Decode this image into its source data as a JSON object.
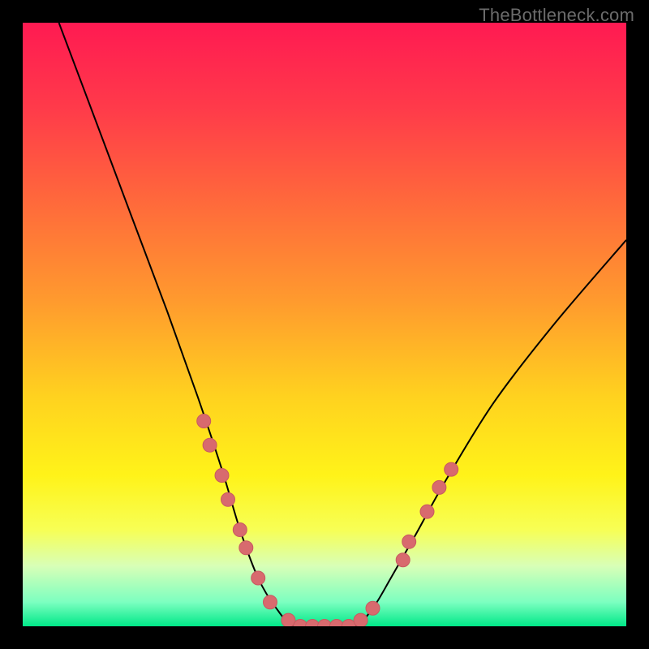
{
  "watermark": "TheBottleneck.com",
  "colors": {
    "gradient_stops": [
      {
        "offset": 0.0,
        "color": "#ff1a52"
      },
      {
        "offset": 0.14,
        "color": "#ff3a4a"
      },
      {
        "offset": 0.3,
        "color": "#ff6a3b"
      },
      {
        "offset": 0.46,
        "color": "#ff9a2e"
      },
      {
        "offset": 0.62,
        "color": "#ffd21f"
      },
      {
        "offset": 0.75,
        "color": "#fff319"
      },
      {
        "offset": 0.84,
        "color": "#f7ff55"
      },
      {
        "offset": 0.9,
        "color": "#d8ffb7"
      },
      {
        "offset": 0.96,
        "color": "#7cffc0"
      },
      {
        "offset": 1.0,
        "color": "#00e888"
      }
    ],
    "curve": "#000000",
    "marker_fill": "#d86a6e",
    "marker_stroke": "#c85a60",
    "frame": "#000000"
  },
  "chart_data": {
    "type": "line",
    "title": "",
    "xlabel": "",
    "ylabel": "",
    "xlim": [
      0,
      100
    ],
    "ylim": [
      0,
      100
    ],
    "curve": {
      "comment": "V-shaped bottleneck curve; y is mismatch percent (0 at valley floor).",
      "points": [
        {
          "x": 6,
          "y": 100
        },
        {
          "x": 12,
          "y": 84
        },
        {
          "x": 18,
          "y": 68
        },
        {
          "x": 24,
          "y": 52
        },
        {
          "x": 29,
          "y": 38
        },
        {
          "x": 33,
          "y": 26
        },
        {
          "x": 36,
          "y": 16
        },
        {
          "x": 39,
          "y": 8
        },
        {
          "x": 42,
          "y": 3
        },
        {
          "x": 45,
          "y": 0
        },
        {
          "x": 50,
          "y": 0
        },
        {
          "x": 55,
          "y": 0
        },
        {
          "x": 58,
          "y": 3
        },
        {
          "x": 61,
          "y": 8
        },
        {
          "x": 65,
          "y": 15
        },
        {
          "x": 70,
          "y": 24
        },
        {
          "x": 78,
          "y": 37
        },
        {
          "x": 88,
          "y": 50
        },
        {
          "x": 100,
          "y": 64
        }
      ]
    },
    "markers": {
      "comment": "highlighted sample points along the curve",
      "points": [
        {
          "x": 30,
          "y": 34
        },
        {
          "x": 31,
          "y": 30
        },
        {
          "x": 33,
          "y": 25
        },
        {
          "x": 34,
          "y": 21
        },
        {
          "x": 36,
          "y": 16
        },
        {
          "x": 37,
          "y": 13
        },
        {
          "x": 39,
          "y": 8
        },
        {
          "x": 41,
          "y": 4
        },
        {
          "x": 44,
          "y": 1
        },
        {
          "x": 46,
          "y": 0
        },
        {
          "x": 48,
          "y": 0
        },
        {
          "x": 50,
          "y": 0
        },
        {
          "x": 52,
          "y": 0
        },
        {
          "x": 54,
          "y": 0
        },
        {
          "x": 56,
          "y": 1
        },
        {
          "x": 58,
          "y": 3
        },
        {
          "x": 63,
          "y": 11
        },
        {
          "x": 64,
          "y": 14
        },
        {
          "x": 67,
          "y": 19
        },
        {
          "x": 69,
          "y": 23
        },
        {
          "x": 71,
          "y": 26
        }
      ]
    }
  }
}
